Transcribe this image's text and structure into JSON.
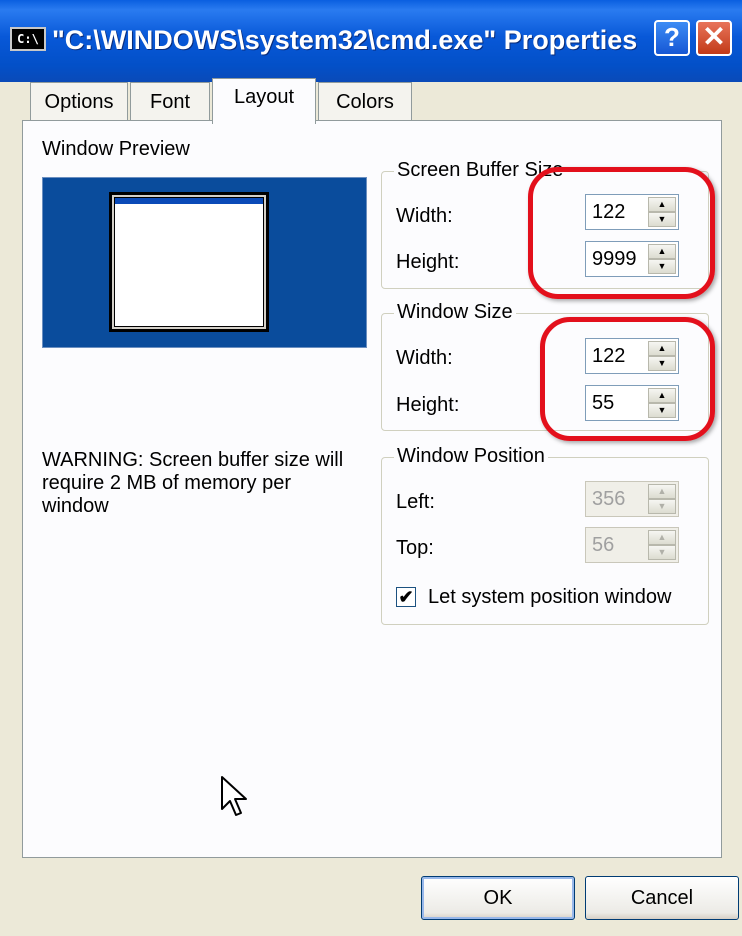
{
  "window": {
    "title": "\"C:\\WINDOWS\\system32\\cmd.exe\" Properties",
    "icon": "cmd-icon",
    "icon_text": "C:\\",
    "help_label": "?",
    "close_label": "✕"
  },
  "tabs": [
    {
      "label": "Options",
      "selected": false
    },
    {
      "label": "Font",
      "selected": false
    },
    {
      "label": "Layout",
      "selected": true
    },
    {
      "label": "Colors",
      "selected": false
    }
  ],
  "preview": {
    "label": "Window Preview",
    "background_color": "#0a4c9c"
  },
  "screen_buffer": {
    "legend": "Screen Buffer Size",
    "width_label": "Width:",
    "width_value": "122",
    "height_label": "Height:",
    "height_value": "9999"
  },
  "window_size": {
    "legend": "Window Size",
    "width_label": "Width:",
    "width_value": "122",
    "height_label": "Height:",
    "height_value": "55"
  },
  "window_position": {
    "legend": "Window Position",
    "left_label": "Left:",
    "left_value": "356",
    "top_label": "Top:",
    "top_value": "56",
    "checkbox_label": "Let system position window",
    "checkbox_checked": true
  },
  "warning": {
    "line1": "WARNING: Screen buffer size will",
    "line2": "require 2 MB of memory per",
    "line3": "window"
  },
  "buttons": {
    "ok": "OK",
    "cancel": "Cancel"
  },
  "annotation_color": "#e3101c"
}
